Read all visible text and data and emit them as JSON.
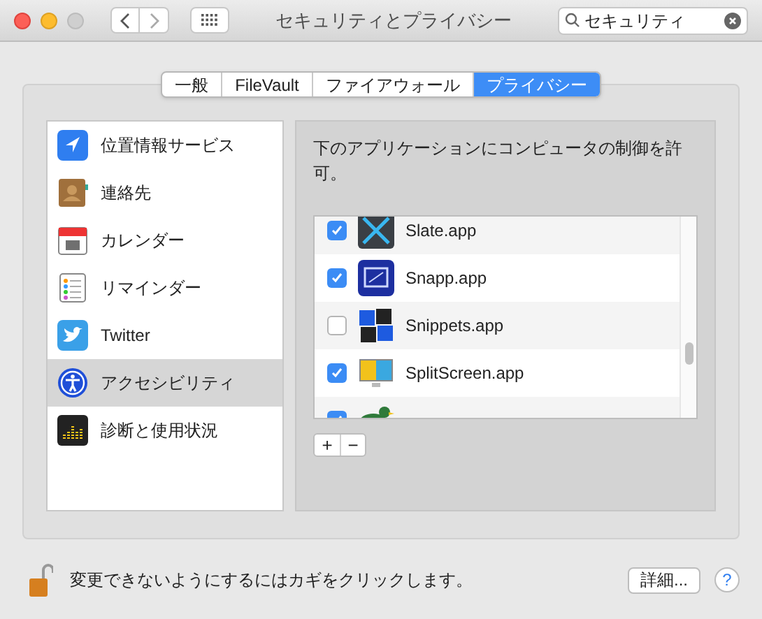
{
  "window": {
    "title": "セキュリティとプライバシー"
  },
  "search": {
    "value": "セキュリティ"
  },
  "tabs": [
    {
      "label": "一般",
      "selected": false
    },
    {
      "label": "FileVault",
      "selected": false
    },
    {
      "label": "ファイアウォール",
      "selected": false
    },
    {
      "label": "プライバシー",
      "selected": true
    }
  ],
  "sidebar": {
    "items": [
      {
        "label": "位置情報サービス",
        "kind": "location",
        "selected": false
      },
      {
        "label": "連絡先",
        "kind": "contacts",
        "selected": false
      },
      {
        "label": "カレンダー",
        "kind": "calendar",
        "selected": false
      },
      {
        "label": "リマインダー",
        "kind": "reminders",
        "selected": false
      },
      {
        "label": "Twitter",
        "kind": "twitter",
        "selected": false
      },
      {
        "label": "アクセシビリティ",
        "kind": "accessibility",
        "selected": true
      },
      {
        "label": "診断と使用状況",
        "kind": "diagnostics",
        "selected": false
      }
    ]
  },
  "content": {
    "heading": "下のアプリケーションにコンピュータの制御を許可。",
    "apps": [
      {
        "name": "Slate.app",
        "kind": "slate",
        "checked": true
      },
      {
        "name": "Snapp.app",
        "kind": "snapp",
        "checked": true
      },
      {
        "name": "Snippets.app",
        "kind": "snippets",
        "checked": false
      },
      {
        "name": "SplitScreen.app",
        "kind": "splitscreen",
        "checked": true
      },
      {
        "kind": "duck",
        "checked": true
      }
    ],
    "buttons": [
      "+",
      "−"
    ]
  },
  "footer": {
    "lock_text": "変更できないようにするにはカギをクリックします。",
    "details_button": "詳細...",
    "help_button": "?"
  }
}
